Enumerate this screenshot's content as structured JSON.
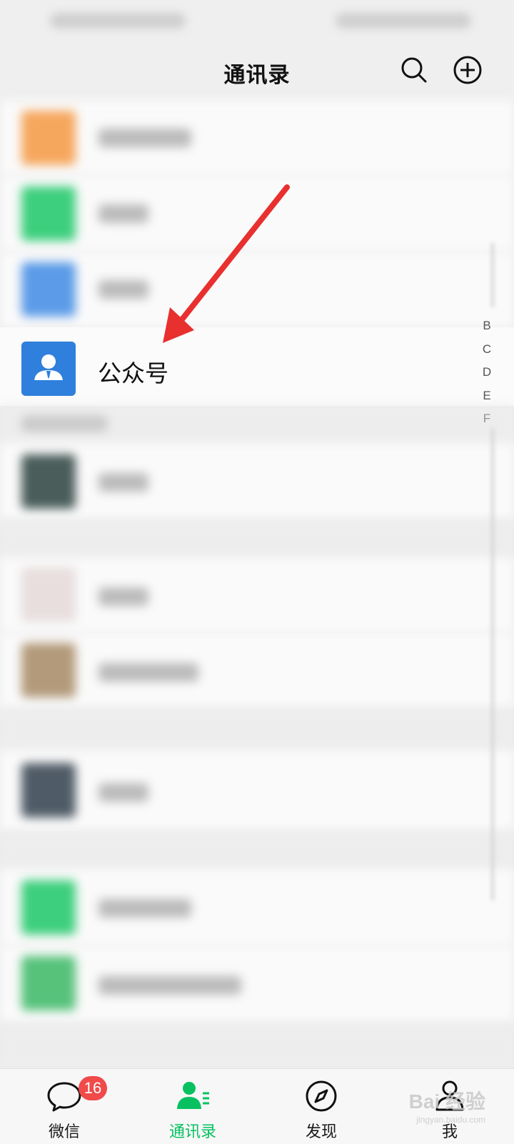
{
  "header": {
    "title": "通讯录"
  },
  "special_entry": {
    "label": "公众号"
  },
  "index_letters": [
    "B",
    "C",
    "D",
    "E",
    "F"
  ],
  "tabs": [
    {
      "label": "微信",
      "badge": "16"
    },
    {
      "label": "通讯录"
    },
    {
      "label": "发现"
    },
    {
      "label": "我"
    }
  ],
  "colors": {
    "accent": "#07c160",
    "badge": "#f04a4a",
    "official_account_icon": "#2f7fdc",
    "annotation_arrow": "#e8302f"
  },
  "watermark": {
    "brand": "Bai 经验",
    "url": "jingyan.baidu.com"
  }
}
